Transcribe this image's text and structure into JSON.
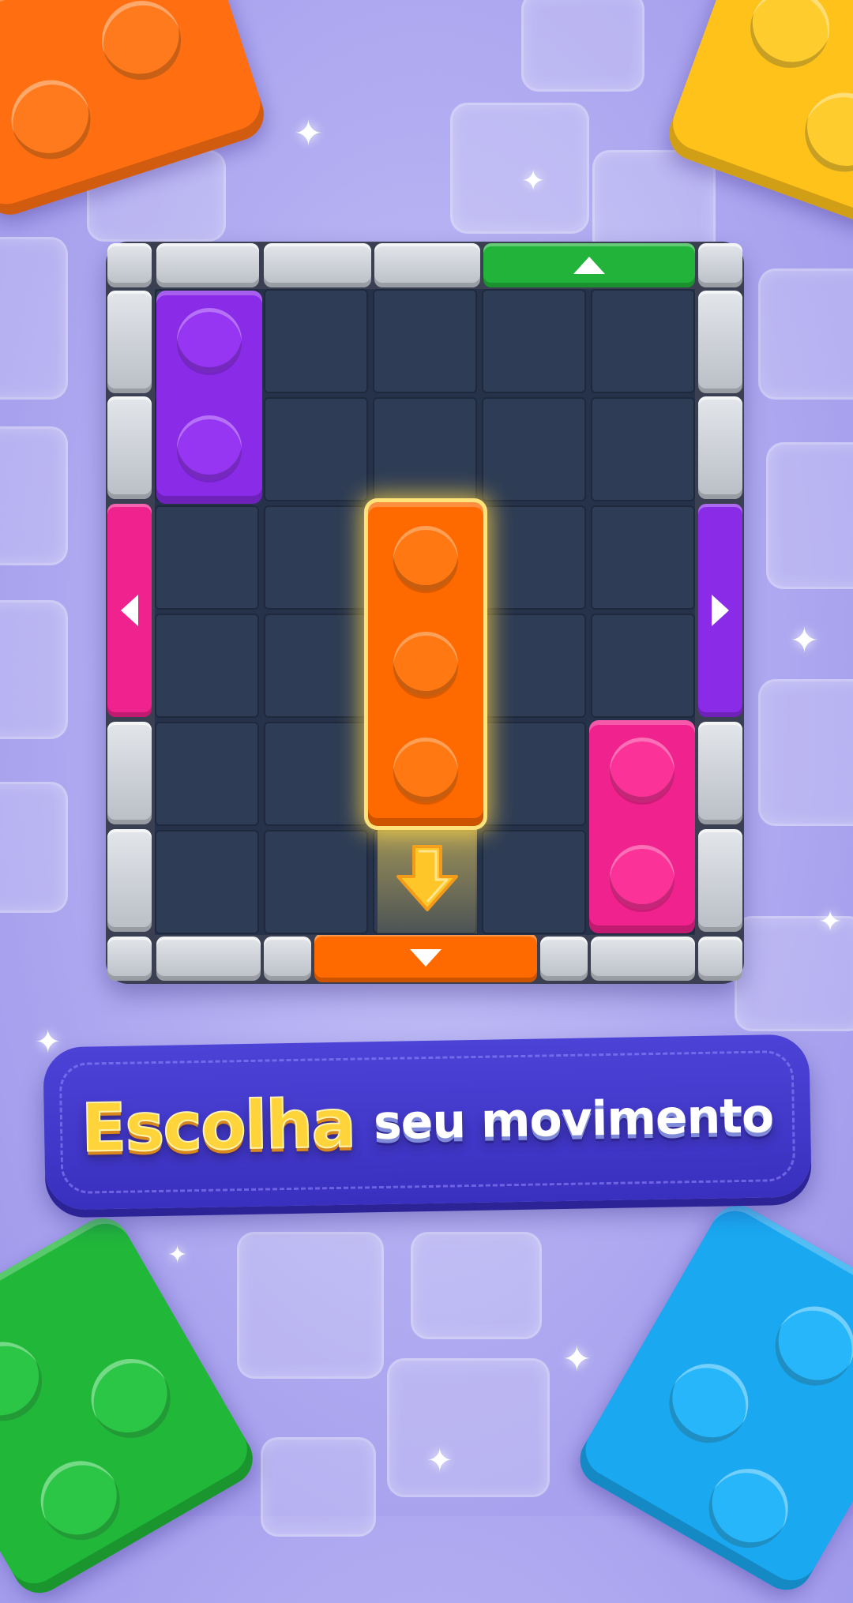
{
  "banner": {
    "highlight": "Escolha",
    "rest": "seu movimento"
  },
  "colors": {
    "purple": "#8a2be8",
    "magenta": "#f0228e",
    "orange": "#ff6a00",
    "green": "#22b43a",
    "gray_wall": "#c7cbd2",
    "board_cell": "#2e3c55",
    "selection_glow": "#ffd84a"
  },
  "board": {
    "columns": 5,
    "rows": 6,
    "blocks": [
      {
        "name": "purple-block",
        "color": "purple",
        "col": 1,
        "row": 1,
        "length": 2,
        "orientation": "vertical"
      },
      {
        "name": "orange-block",
        "color": "orange",
        "col": 3,
        "row": 3,
        "length": 3,
        "orientation": "vertical",
        "selected": true
      },
      {
        "name": "magenta-block",
        "color": "magenta",
        "col": 5,
        "row": 5,
        "length": 2,
        "orientation": "vertical"
      }
    ],
    "exits": [
      {
        "name": "green-exit",
        "color": "green",
        "side": "top",
        "direction": "up"
      },
      {
        "name": "magenta-exit",
        "color": "magenta",
        "side": "left",
        "direction": "left"
      },
      {
        "name": "purple-exit",
        "color": "purple",
        "side": "right",
        "direction": "right"
      },
      {
        "name": "orange-exit",
        "color": "orange",
        "side": "bottom",
        "direction": "down"
      }
    ],
    "move_hint": "down-arrow-icon"
  }
}
